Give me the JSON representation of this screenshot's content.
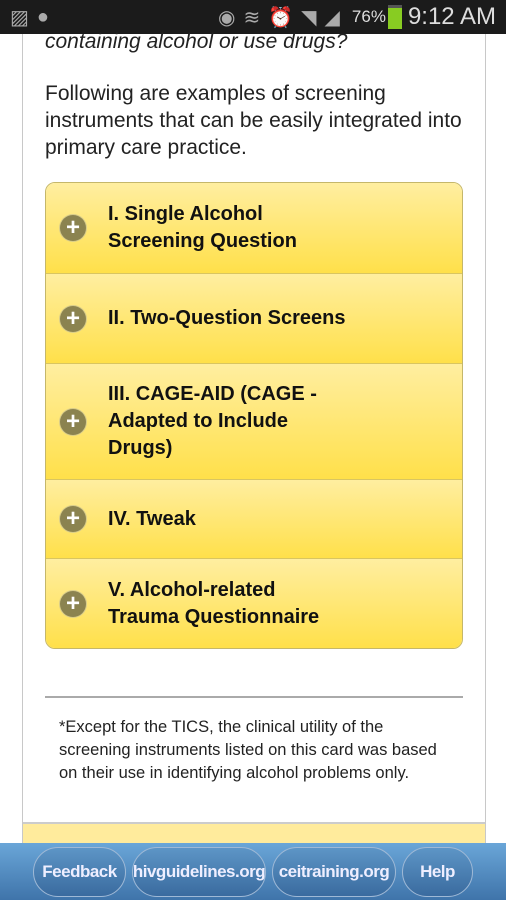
{
  "status_bar": {
    "battery": "76%",
    "time": "9:12 AM",
    "icons": [
      "image-icon",
      "bulb-icon",
      "eye-icon",
      "vibrate-icon",
      "alarm-icon",
      "wifi-icon",
      "signal-icon",
      "battery-charging-icon"
    ]
  },
  "content": {
    "question_tail": "containing alcohol or use drugs?",
    "intro": "Following are examples of screening instruments that can be easily integrated into primary care practice.",
    "accordion": [
      {
        "label": "I. Single Alcohol Screening Question"
      },
      {
        "label": "II. Two-Question Screens"
      },
      {
        "label": "III. CAGE-AID (CAGE - Adapted to Include Drugs)"
      },
      {
        "label": "IV. Tweak"
      },
      {
        "label": "V. Alcohol-related Trauma Questionnaire"
      }
    ],
    "note": "*Except for the TICS, the clinical utility of the screening instruments listed on this card was based on their use in identifying alcohol problems only."
  },
  "footer": {
    "buttons": [
      "Feedback",
      "hivguidelines.org",
      "ceitraining.org",
      "Help"
    ]
  },
  "colors": {
    "accordion": "#ffe04a",
    "footer": "#4f86bb"
  }
}
